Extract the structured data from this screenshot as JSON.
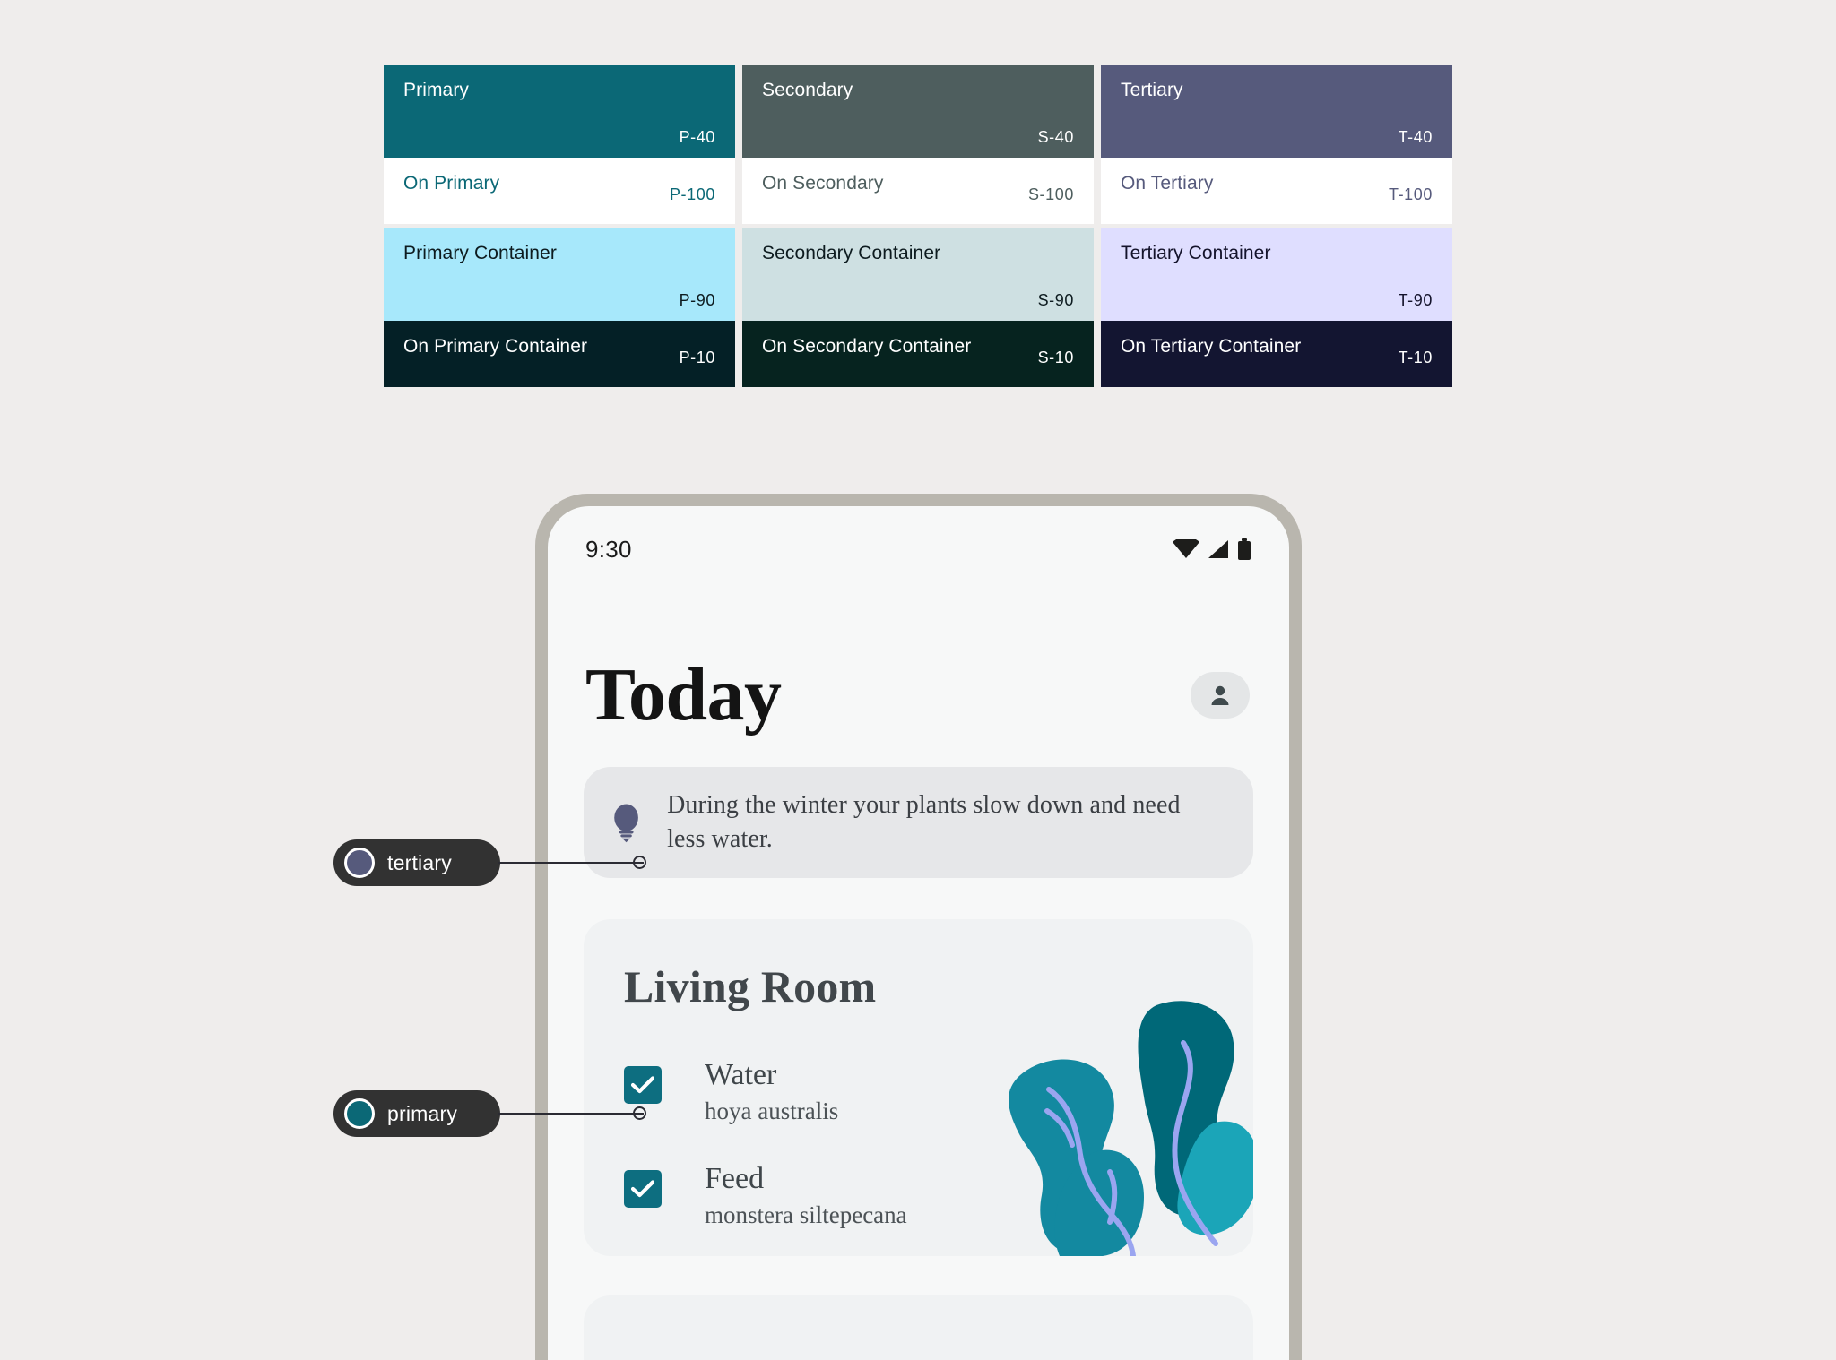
{
  "palette": {
    "columns": [
      {
        "key": "primary",
        "rows": [
          {
            "name": "Primary",
            "code": "P-40",
            "bg": "#0b6876",
            "fg": "#ffffff",
            "size": "tall"
          },
          {
            "name": "On Primary",
            "code": "P-100",
            "bg": "#ffffff",
            "fg": "#0b6876",
            "size": "short"
          },
          {
            "name": "Primary Container",
            "code": "P-90",
            "bg": "#a7e8fb",
            "fg": "#0d1b1f",
            "size": "tall"
          },
          {
            "name": "On Primary Container",
            "code": "P-10",
            "bg": "#042026",
            "fg": "#ffffff",
            "size": "short"
          }
        ]
      },
      {
        "key": "secondary",
        "rows": [
          {
            "name": "Secondary",
            "code": "S-40",
            "bg": "#4e5e5e",
            "fg": "#ffffff",
            "size": "tall"
          },
          {
            "name": "On Secondary",
            "code": "S-100",
            "bg": "#ffffff",
            "fg": "#4e5e5e",
            "size": "short"
          },
          {
            "name": "Secondary Container",
            "code": "S-90",
            "bg": "#cee0e2",
            "fg": "#0d1b1f",
            "size": "tall"
          },
          {
            "name": "On Secondary Container",
            "code": "S-10",
            "bg": "#06231f",
            "fg": "#ffffff",
            "size": "short"
          }
        ]
      },
      {
        "key": "tertiary",
        "rows": [
          {
            "name": "Tertiary",
            "code": "T-40",
            "bg": "#565a7c",
            "fg": "#ffffff",
            "size": "tall"
          },
          {
            "name": "On Tertiary",
            "code": "T-100",
            "bg": "#ffffff",
            "fg": "#565a7c",
            "size": "short"
          },
          {
            "name": "Tertiary Container",
            "code": "T-90",
            "bg": "#dfdeff",
            "fg": "#14132b",
            "size": "tall"
          },
          {
            "name": "On Tertiary Container",
            "code": "T-10",
            "bg": "#131531",
            "fg": "#ffffff",
            "size": "short"
          }
        ]
      }
    ]
  },
  "phone": {
    "status": {
      "time": "9:30",
      "icons": [
        "wifi-icon",
        "signal-icon",
        "battery-icon"
      ]
    },
    "header": {
      "title": "Today",
      "avatar_icon": "person-icon"
    },
    "tip": {
      "icon": "lightbulb-icon",
      "text": "During the winter your plants slow down and need less water."
    },
    "room": {
      "title": "Living Room",
      "tasks": [
        {
          "title": "Water",
          "subtitle": "hoya australis",
          "checked": true
        },
        {
          "title": "Feed",
          "subtitle": "monstera siltepecana",
          "checked": true
        }
      ],
      "illustration": "plant-illustration"
    }
  },
  "annotations": [
    {
      "label": "tertiary",
      "dot_color": "#565a7c"
    },
    {
      "label": "primary",
      "dot_color": "#0b6876"
    }
  ],
  "colors": {
    "page_background": "#efedec",
    "phone_frame": "#b9b6ae",
    "phone_screen": "#f7f8f8",
    "tip_card": "#e6e7e9",
    "room_card": "#f0f2f3",
    "checkbox": "#0d6e80",
    "plant_dark": "#006878",
    "plant_mid": "#1389a0",
    "plant_light": "#1ba5b8",
    "plant_stem": "#9aa5f0",
    "annotation_pill": "#323232"
  }
}
